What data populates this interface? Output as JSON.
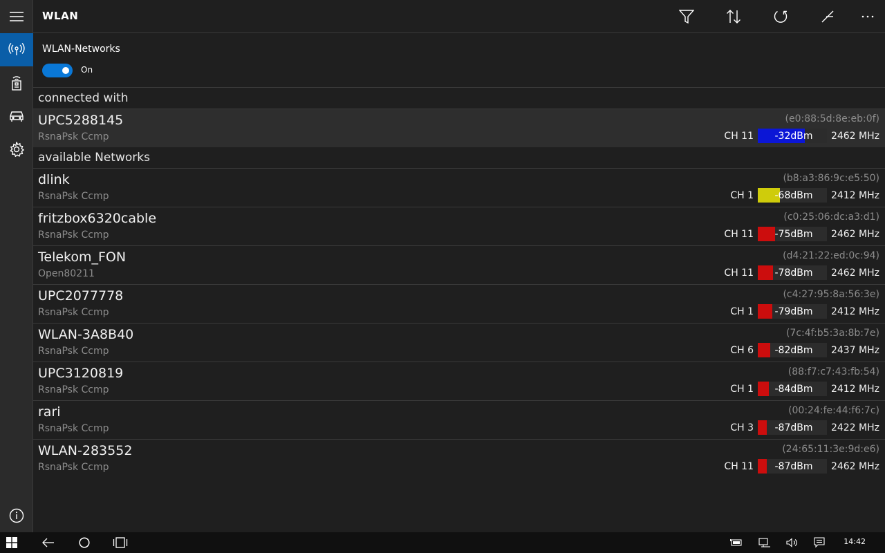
{
  "app": {
    "title": "WLAN"
  },
  "toggle": {
    "label": "WLAN-Networks",
    "state": "On"
  },
  "groups": {
    "connected": "connected with",
    "available": "available Networks"
  },
  "connected": [
    {
      "ssid": "UPC5288145",
      "enc": "RsnaPsk Ccmp",
      "mac": "(e0:88:5d:8e:eb:0f)",
      "ch": "CH 11",
      "dbm": "-32dBm",
      "freq": "2462 MHz",
      "level": 0.68,
      "color": "#0b16d6"
    }
  ],
  "networks": [
    {
      "ssid": "dlink",
      "enc": "RsnaPsk Ccmp",
      "mac": "(b8:a3:86:9c:e5:50)",
      "ch": "CH 1",
      "dbm": "-68dBm",
      "freq": "2412 MHz",
      "level": 0.32,
      "color": "#cfcc0b"
    },
    {
      "ssid": "fritzbox6320cable",
      "enc": "RsnaPsk Ccmp",
      "mac": "(c0:25:06:dc:a3:d1)",
      "ch": "CH 11",
      "dbm": "-75dBm",
      "freq": "2462 MHz",
      "level": 0.25,
      "color": "#cc0d0d"
    },
    {
      "ssid": "Telekom_FON",
      "enc": "Open80211",
      "mac": "(d4:21:22:ed:0c:94)",
      "ch": "CH 11",
      "dbm": "-78dBm",
      "freq": "2462 MHz",
      "level": 0.22,
      "color": "#cc0d0d"
    },
    {
      "ssid": "UPC2077778",
      "enc": "RsnaPsk Ccmp",
      "mac": "(c4:27:95:8a:56:3e)",
      "ch": "CH 1",
      "dbm": "-79dBm",
      "freq": "2412 MHz",
      "level": 0.21,
      "color": "#cc0d0d"
    },
    {
      "ssid": "WLAN-3A8B40",
      "enc": "RsnaPsk Ccmp",
      "mac": "(7c:4f:b5:3a:8b:7e)",
      "ch": "CH 6",
      "dbm": "-82dBm",
      "freq": "2437 MHz",
      "level": 0.18,
      "color": "#cc0d0d"
    },
    {
      "ssid": "UPC3120819",
      "enc": "RsnaPsk Ccmp",
      "mac": "(88:f7:c7:43:fb:54)",
      "ch": "CH 1",
      "dbm": "-84dBm",
      "freq": "2412 MHz",
      "level": 0.16,
      "color": "#cc0d0d"
    },
    {
      "ssid": "rari",
      "enc": "RsnaPsk Ccmp",
      "mac": "(00:24:fe:44:f6:7c)",
      "ch": "CH 3",
      "dbm": "-87dBm",
      "freq": "2422 MHz",
      "level": 0.13,
      "color": "#cc0d0d"
    },
    {
      "ssid": "WLAN-283552",
      "enc": "RsnaPsk Ccmp",
      "mac": "(24:65:11:3e:9d:e6)",
      "ch": "CH 11",
      "dbm": "-87dBm",
      "freq": "2462 MHz",
      "level": 0.13,
      "color": "#cc0d0d"
    }
  ],
  "icons": {
    "header": [
      "filter-icon",
      "sort-icon",
      "refresh-icon",
      "compare-icon",
      "more-icon"
    ],
    "rail": [
      "hamburger-icon",
      "wifi-antenna-icon",
      "router-icon",
      "car-icon",
      "gear-icon",
      "info-icon"
    ]
  },
  "taskbar": {
    "clock": "14:42"
  }
}
